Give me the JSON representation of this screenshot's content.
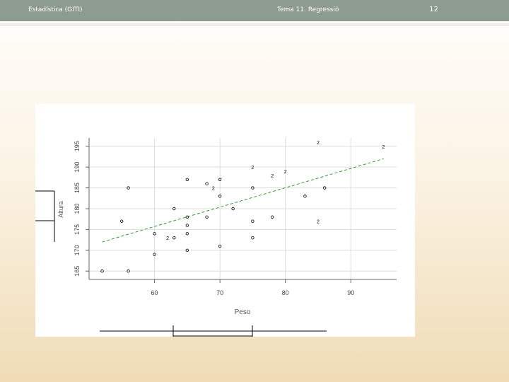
{
  "slide": {
    "header_left": "Estadística (GITI)",
    "header_center": "Tema 11. Regressió",
    "page_number": "12"
  },
  "colors": {
    "header_bar": "#8e9b91",
    "fit_line": "#2e9a2e",
    "points": "#000000"
  },
  "chart_data": {
    "type": "scatter",
    "xlabel": "Peso",
    "ylabel": "Altura",
    "x_ticks": [
      60,
      70,
      80,
      90
    ],
    "y_ticks": [
      165,
      170,
      175,
      180,
      185,
      190,
      195
    ],
    "xlim": [
      50,
      97
    ],
    "ylim": [
      163,
      197
    ],
    "grid": true,
    "points": [
      {
        "x": 52,
        "y": 165,
        "marker": "o"
      },
      {
        "x": 55,
        "y": 177,
        "marker": "o"
      },
      {
        "x": 56,
        "y": 165,
        "marker": "o"
      },
      {
        "x": 56,
        "y": 185,
        "marker": "o"
      },
      {
        "x": 60,
        "y": 169,
        "marker": "o"
      },
      {
        "x": 60,
        "y": 174,
        "marker": "o"
      },
      {
        "x": 62,
        "y": 173,
        "marker": "2"
      },
      {
        "x": 63,
        "y": 173,
        "marker": "o"
      },
      {
        "x": 63,
        "y": 180,
        "marker": "o"
      },
      {
        "x": 65,
        "y": 170,
        "marker": "o"
      },
      {
        "x": 65,
        "y": 174,
        "marker": "o"
      },
      {
        "x": 65,
        "y": 176,
        "marker": "o"
      },
      {
        "x": 65,
        "y": 178,
        "marker": "o"
      },
      {
        "x": 65,
        "y": 187,
        "marker": "o"
      },
      {
        "x": 68,
        "y": 178,
        "marker": "o"
      },
      {
        "x": 68,
        "y": 186,
        "marker": "o"
      },
      {
        "x": 69,
        "y": 185,
        "marker": "2"
      },
      {
        "x": 70,
        "y": 171,
        "marker": "o"
      },
      {
        "x": 70,
        "y": 183,
        "marker": "o"
      },
      {
        "x": 70,
        "y": 187,
        "marker": "o"
      },
      {
        "x": 72,
        "y": 180,
        "marker": "o"
      },
      {
        "x": 75,
        "y": 173,
        "marker": "o"
      },
      {
        "x": 75,
        "y": 177,
        "marker": "o"
      },
      {
        "x": 75,
        "y": 185,
        "marker": "o"
      },
      {
        "x": 75,
        "y": 190,
        "marker": "2"
      },
      {
        "x": 78,
        "y": 178,
        "marker": "o"
      },
      {
        "x": 78,
        "y": 188,
        "marker": "2"
      },
      {
        "x": 80,
        "y": 189,
        "marker": "2"
      },
      {
        "x": 83,
        "y": 183,
        "marker": "o"
      },
      {
        "x": 85,
        "y": 177,
        "marker": "2"
      },
      {
        "x": 85,
        "y": 196,
        "marker": "2"
      },
      {
        "x": 86,
        "y": 185,
        "marker": "o"
      },
      {
        "x": 95,
        "y": 195,
        "marker": "2"
      }
    ],
    "fit_line": {
      "x": [
        52,
        95
      ],
      "y": [
        172,
        192
      ]
    }
  }
}
